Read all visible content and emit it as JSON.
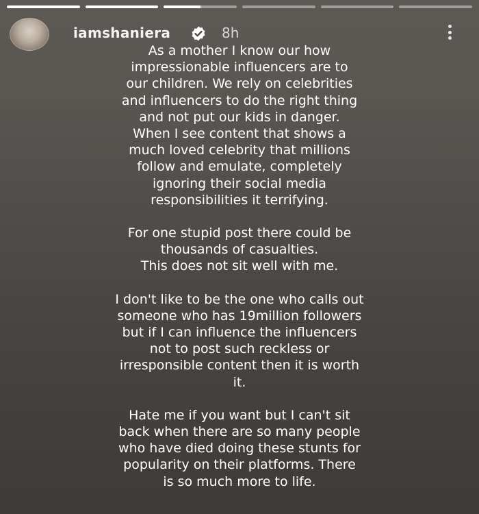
{
  "story": {
    "progress_segments": [
      1,
      1,
      0.5,
      0,
      0,
      0
    ],
    "username": "iamshaniera",
    "timestamp": "8h",
    "paragraphs": [
      [
        "As a mother I know our how",
        "impressionable influencers are to",
        "our children. We rely on celebrities",
        "and influencers to do the right thing",
        "and not put our kids in danger.",
        "When I see content that shows a",
        "much loved celebrity that millions",
        "follow and emulate, completely",
        "ignoring their social media",
        "responsibilities it terrifying."
      ],
      [
        "For one stupid post there could be",
        "thousands of casualties.",
        "This does not sit well with me."
      ],
      [
        "I don't like to be the one who calls out",
        "someone who has 19million followers",
        "but if I can influence the influencers",
        "not to post such reckless or",
        "irresponsible content then it is worth",
        "it."
      ],
      [
        "Hate me if you want but I can't sit",
        "back when there are so many people",
        "who have died doing these stunts for",
        "popularity on their platforms. There",
        "is so much more to life."
      ]
    ]
  },
  "icons": {
    "verified": "verified-badge-icon",
    "more": "more-options-icon"
  },
  "colors": {
    "verified_badge": "#ffffff",
    "background_top": "#5c5854",
    "background_bottom": "#3e3a37"
  }
}
